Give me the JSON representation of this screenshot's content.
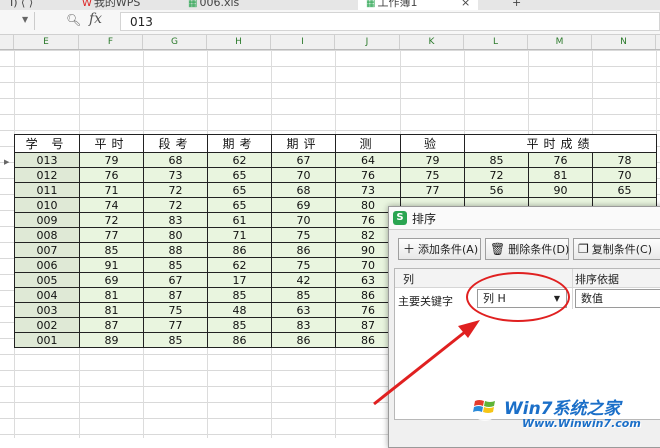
{
  "tabs": [
    {
      "label": "我的WPS",
      "icon": "wps-icon"
    },
    {
      "label": "006.xls",
      "icon": "sheet-icon"
    },
    {
      "label": "工作簿1",
      "icon": "sheet-icon"
    }
  ],
  "new_tab_label": "+",
  "formula_bar": {
    "fx_label": "fx",
    "value": "013"
  },
  "columns": [
    "E",
    "F",
    "G",
    "H",
    "I",
    "J",
    "K",
    "L",
    "M",
    "N"
  ],
  "table": {
    "headers": [
      "学 号",
      "平时",
      "段考",
      "期考",
      "期评",
      "测",
      "验",
      "平时成绩"
    ],
    "rows": [
      [
        "013",
        "79",
        "68",
        "62",
        "67",
        "64",
        "79",
        "85",
        "76",
        "78"
      ],
      [
        "012",
        "76",
        "73",
        "65",
        "70",
        "76",
        "75",
        "72",
        "81",
        "70"
      ],
      [
        "011",
        "71",
        "72",
        "65",
        "68",
        "73",
        "77",
        "56",
        "90",
        "65"
      ],
      [
        "010",
        "74",
        "72",
        "65",
        "69",
        "80"
      ],
      [
        "009",
        "72",
        "83",
        "61",
        "70",
        "76"
      ],
      [
        "008",
        "77",
        "80",
        "71",
        "75",
        "82"
      ],
      [
        "007",
        "85",
        "88",
        "86",
        "86",
        "90"
      ],
      [
        "006",
        "91",
        "85",
        "62",
        "75",
        "70"
      ],
      [
        "005",
        "69",
        "67",
        "17",
        "42",
        "63"
      ],
      [
        "004",
        "81",
        "87",
        "85",
        "85",
        "86"
      ],
      [
        "003",
        "81",
        "75",
        "48",
        "63",
        "76"
      ],
      [
        "002",
        "87",
        "77",
        "85",
        "83",
        "87"
      ],
      [
        "001",
        "89",
        "85",
        "86",
        "86",
        "86"
      ]
    ]
  },
  "dialog": {
    "title": "排序",
    "buttons": {
      "add": "添加条件(A)",
      "delete": "删除条件(D)",
      "copy": "复制条件(C)"
    },
    "col_header": "列",
    "basis_header": "排序依据",
    "primary_key_label": "主要关键字",
    "selected_column": "列 H",
    "basis_value": "数值"
  },
  "watermark": {
    "brand": "Win7系统之家",
    "url": "Www.Winwin7.com"
  },
  "colors": {
    "grid_header_text": "#2b7a2b",
    "data_fill": "#e9f5df",
    "annotation": "#e02020",
    "watermark": "#1b6fc8"
  }
}
